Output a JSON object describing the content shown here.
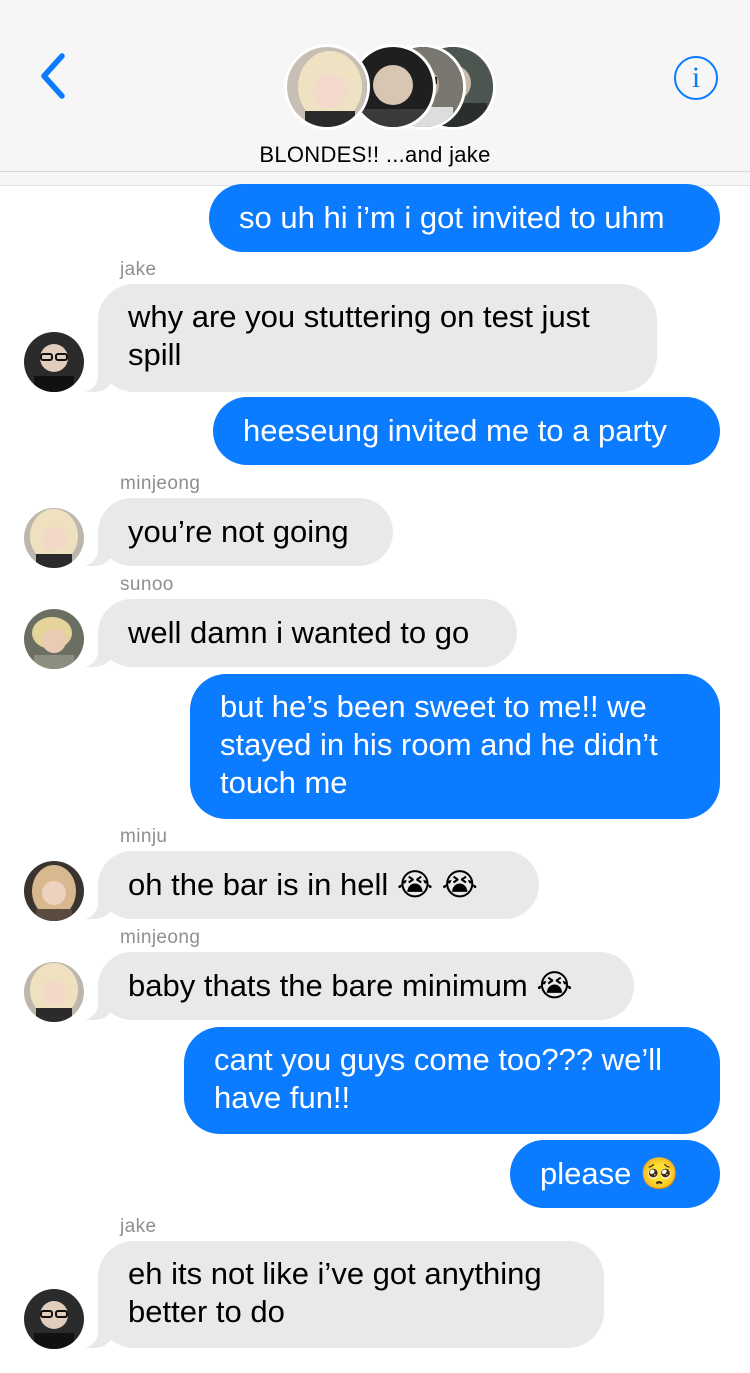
{
  "header": {
    "back_icon": "chevron-left-icon",
    "info_icon": "info-icon",
    "info_glyph": "i",
    "title": "BLONDES!! ...and jake",
    "accent": "#0a7aff"
  },
  "messages": [
    {
      "dir": "out",
      "text": "so uh hi i’m i got invited to uhm"
    },
    {
      "dir": "in",
      "sender": "jake",
      "text": "why are you stuttering on test just spill"
    },
    {
      "dir": "out",
      "text": "heeseung invited me to a party"
    },
    {
      "dir": "in",
      "sender": "minjeong",
      "text": "you’re not going"
    },
    {
      "dir": "in",
      "sender": "sunoo",
      "text": "well damn i wanted to go"
    },
    {
      "dir": "out",
      "text": "but he’s been sweet to me!! we stayed in his room and he didn’t touch me"
    },
    {
      "dir": "in",
      "sender": "minju",
      "text": "oh the bar is in hell 😭 😭"
    },
    {
      "dir": "in",
      "sender": "minjeong",
      "text": "baby thats the bare minimum 😭"
    },
    {
      "dir": "out",
      "text": "cant you guys come too??? we’ll have fun!!"
    },
    {
      "dir": "out",
      "text": "please 🥺"
    },
    {
      "dir": "in",
      "sender": "jake",
      "text": "eh its not like i’ve got anything better to do"
    }
  ],
  "colors": {
    "outgoing": "#0b7bff",
    "incoming": "#e9e9eb"
  }
}
